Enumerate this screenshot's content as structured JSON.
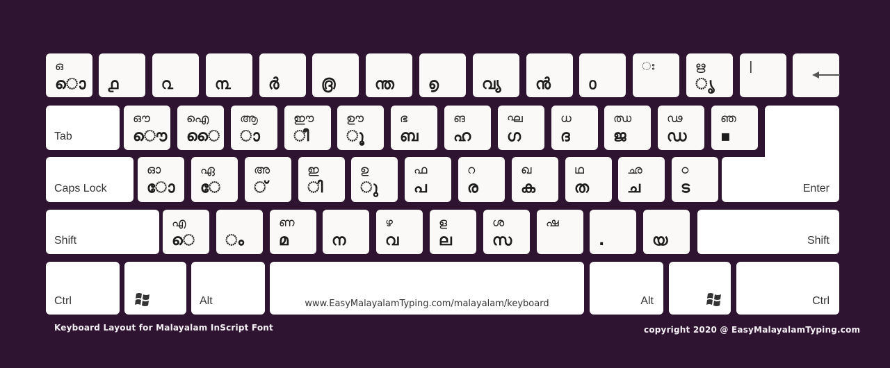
{
  "colors": {
    "background": "#2e1430",
    "key": "#faf9f7",
    "key_text": "#1c1c1c"
  },
  "rows": {
    "r1": [
      {
        "shift": "ഒ",
        "base": "ൊ"
      },
      {
        "shift": "",
        "base": "൧"
      },
      {
        "shift": "",
        "base": "൨"
      },
      {
        "shift": "",
        "base": "൩"
      },
      {
        "shift": "",
        "base": "ർ"
      },
      {
        "shift": "",
        "base": "൫"
      },
      {
        "shift": "",
        "base": "ന്ത"
      },
      {
        "shift": "",
        "base": "൭"
      },
      {
        "shift": "",
        "base": "വ്യ"
      },
      {
        "shift": "",
        "base": "ൻ"
      },
      {
        "shift": "",
        "base": "൦"
      },
      {
        "shift": "ഃ",
        "base": ""
      },
      {
        "shift": "ഋ",
        "base": "ൃ"
      },
      {
        "shift": "|",
        "base": ""
      },
      {
        "icon": "backspace-arrow-icon"
      }
    ],
    "r2": [
      {
        "label": "Tab"
      },
      {
        "shift": "ഔ",
        "base": "ൌ"
      },
      {
        "shift": "ഐ",
        "base": "ൈ"
      },
      {
        "shift": "ആ",
        "base": "ാ"
      },
      {
        "shift": "ഈ",
        "base": "ീ"
      },
      {
        "shift": "ഊ",
        "base": "ൂ"
      },
      {
        "shift": "ഭ",
        "base": "ബ"
      },
      {
        "shift": "ങ",
        "base": "ഹ"
      },
      {
        "shift": "ഘ",
        "base": "ഗ"
      },
      {
        "shift": "ധ",
        "base": "ദ"
      },
      {
        "shift": "ഝ",
        "base": "ജ"
      },
      {
        "shift": "ഢ",
        "base": "ഡ"
      },
      {
        "shift": "ഞ",
        "base": "▪"
      }
    ],
    "r3": [
      {
        "label": "Caps Lock"
      },
      {
        "shift": "ഓ",
        "base": "ോ"
      },
      {
        "shift": "ഏ",
        "base": "േ"
      },
      {
        "shift": "അ",
        "base": "്"
      },
      {
        "shift": "ഇ",
        "base": "ി"
      },
      {
        "shift": "ഉ",
        "base": "ു"
      },
      {
        "shift": "ഫ",
        "base": "പ"
      },
      {
        "shift": "റ",
        "base": "ര"
      },
      {
        "shift": "ഖ",
        "base": "ക"
      },
      {
        "shift": "ഥ",
        "base": "ത"
      },
      {
        "shift": "ഛ",
        "base": "ച"
      },
      {
        "shift": "ഠ",
        "base": "ട"
      },
      {
        "label": "Enter"
      }
    ],
    "r4": [
      {
        "label": "Shift"
      },
      {
        "shift": "എ",
        "base": "െ"
      },
      {
        "shift": "",
        "base": "ം"
      },
      {
        "shift": "ണ",
        "base": "മ"
      },
      {
        "shift": "",
        "base": "ന"
      },
      {
        "shift": "ഴ",
        "base": "വ"
      },
      {
        "shift": "ള",
        "base": "ല"
      },
      {
        "shift": "ശ",
        "base": "സ"
      },
      {
        "shift": "ഷ",
        "base": ""
      },
      {
        "shift": "",
        "base": "."
      },
      {
        "shift": "",
        "base": "യ"
      },
      {
        "label": "Shift"
      }
    ],
    "r5": {
      "ctrl_left": "Ctrl",
      "alt_left": "Alt",
      "space": "www.EasyMalayalamTyping.com/malayalam/keyboard",
      "alt_right": "Alt",
      "ctrl_right": "Ctrl"
    }
  },
  "footer": {
    "title": "Keyboard Layout for Malayalam InScript Font",
    "copyright": "copyright 2020 @ EasyMalayalamTyping.com"
  }
}
